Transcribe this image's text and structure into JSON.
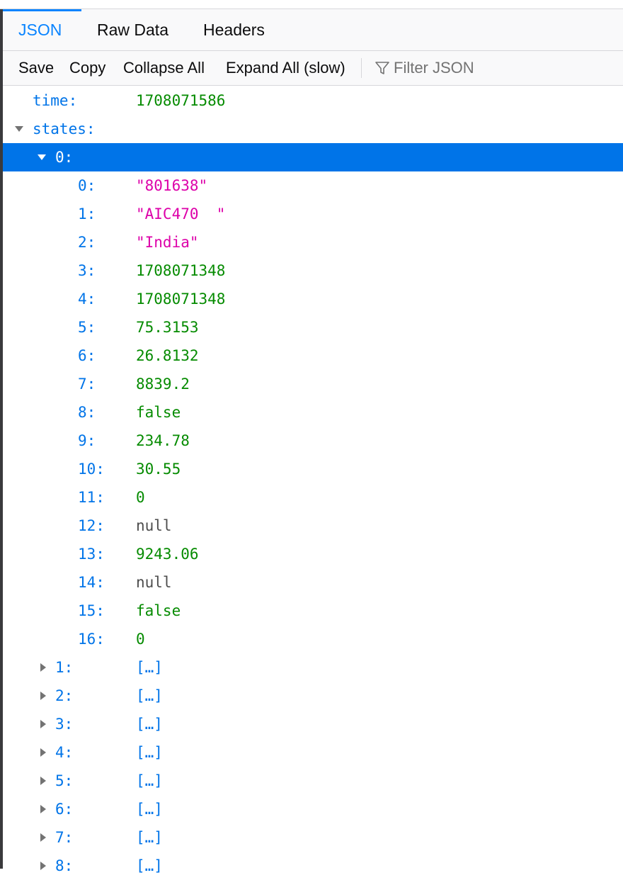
{
  "tabs": [
    {
      "label": "JSON",
      "selected": true
    },
    {
      "label": "Raw Data",
      "selected": false
    },
    {
      "label": "Headers",
      "selected": false
    }
  ],
  "toolbar": {
    "save_label": "Save",
    "copy_label": "Copy",
    "collapse_all_label": "Collapse All",
    "expand_all_label": "Expand All (slow)",
    "filter_placeholder": "Filter JSON",
    "filter_icon": "funnel-icon"
  },
  "colors": {
    "accent": "#0a84ff",
    "selected_row": "#0074e8",
    "key": "#0074e8",
    "number": "#058b00",
    "string": "#dd00a9",
    "null": "#4d4d4d"
  },
  "tree": {
    "time": {
      "key": "time:",
      "value": "1708071586"
    },
    "states_key": "states:",
    "state0_key": "0:",
    "state0_items": [
      {
        "key": "0:",
        "value": "\"801638\"",
        "type": "string"
      },
      {
        "key": "1:",
        "value": "\"AIC470  \"",
        "type": "string"
      },
      {
        "key": "2:",
        "value": "\"India\"",
        "type": "string"
      },
      {
        "key": "3:",
        "value": "1708071348",
        "type": "number"
      },
      {
        "key": "4:",
        "value": "1708071348",
        "type": "number"
      },
      {
        "key": "5:",
        "value": "75.3153",
        "type": "number"
      },
      {
        "key": "6:",
        "value": "26.8132",
        "type": "number"
      },
      {
        "key": "7:",
        "value": "8839.2",
        "type": "number"
      },
      {
        "key": "8:",
        "value": "false",
        "type": "bool"
      },
      {
        "key": "9:",
        "value": "234.78",
        "type": "number"
      },
      {
        "key": "10:",
        "value": "30.55",
        "type": "number"
      },
      {
        "key": "11:",
        "value": "0",
        "type": "number"
      },
      {
        "key": "12:",
        "value": "null",
        "type": "null"
      },
      {
        "key": "13:",
        "value": "9243.06",
        "type": "number"
      },
      {
        "key": "14:",
        "value": "null",
        "type": "null"
      },
      {
        "key": "15:",
        "value": "false",
        "type": "bool"
      },
      {
        "key": "16:",
        "value": "0",
        "type": "number"
      }
    ],
    "collapsed_states": [
      {
        "key": "1:",
        "value": "[…]"
      },
      {
        "key": "2:",
        "value": "[…]"
      },
      {
        "key": "3:",
        "value": "[…]"
      },
      {
        "key": "4:",
        "value": "[…]"
      },
      {
        "key": "5:",
        "value": "[…]"
      },
      {
        "key": "6:",
        "value": "[…]"
      },
      {
        "key": "7:",
        "value": "[…]"
      },
      {
        "key": "8:",
        "value": "[…]"
      }
    ]
  }
}
